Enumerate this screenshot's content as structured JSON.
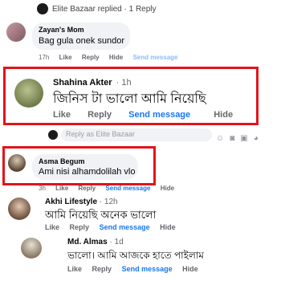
{
  "reply_summary": "Elite Bazaar replied · 1 Reply",
  "comments": [
    {
      "name": "Zayan's Mom",
      "text": "Bag gula onek sundor",
      "time": "17h",
      "like": "Like",
      "reply": "Reply",
      "hide": "Hide",
      "send": "Send message"
    },
    {
      "name": "Shahina Akter",
      "time": "1h",
      "text": "জিনিস টা ভালো আমি নিয়েছি",
      "like": "Like",
      "reply": "Reply",
      "send": "Send message",
      "hide": "Hide"
    },
    {
      "name": "Asma Begum",
      "text": "Ami nisi alhamdolilah vlo",
      "time": "3h",
      "like": "Like",
      "reply": "Reply",
      "send": "Send message",
      "hide": "Hide"
    },
    {
      "name": "Akhi Lifestyle",
      "time": "12h",
      "text": "আমি নিয়েছি অনেক ভালো",
      "like": "Like",
      "reply": "Reply",
      "send": "Send message",
      "hide": "Hide"
    },
    {
      "name": "Md. Almas",
      "time": "1d",
      "text": "ভালো। আমি আজকে হাতে পাইলাম",
      "like": "Like",
      "reply": "Reply",
      "send": "Send message",
      "hide": "Hide"
    }
  ],
  "reply_input": {
    "placeholder": "Reply as Elite Bazaar"
  },
  "colors": {
    "highlight": "#e3141b",
    "link": "#1877f2",
    "bubble": "#f0f2f5"
  }
}
